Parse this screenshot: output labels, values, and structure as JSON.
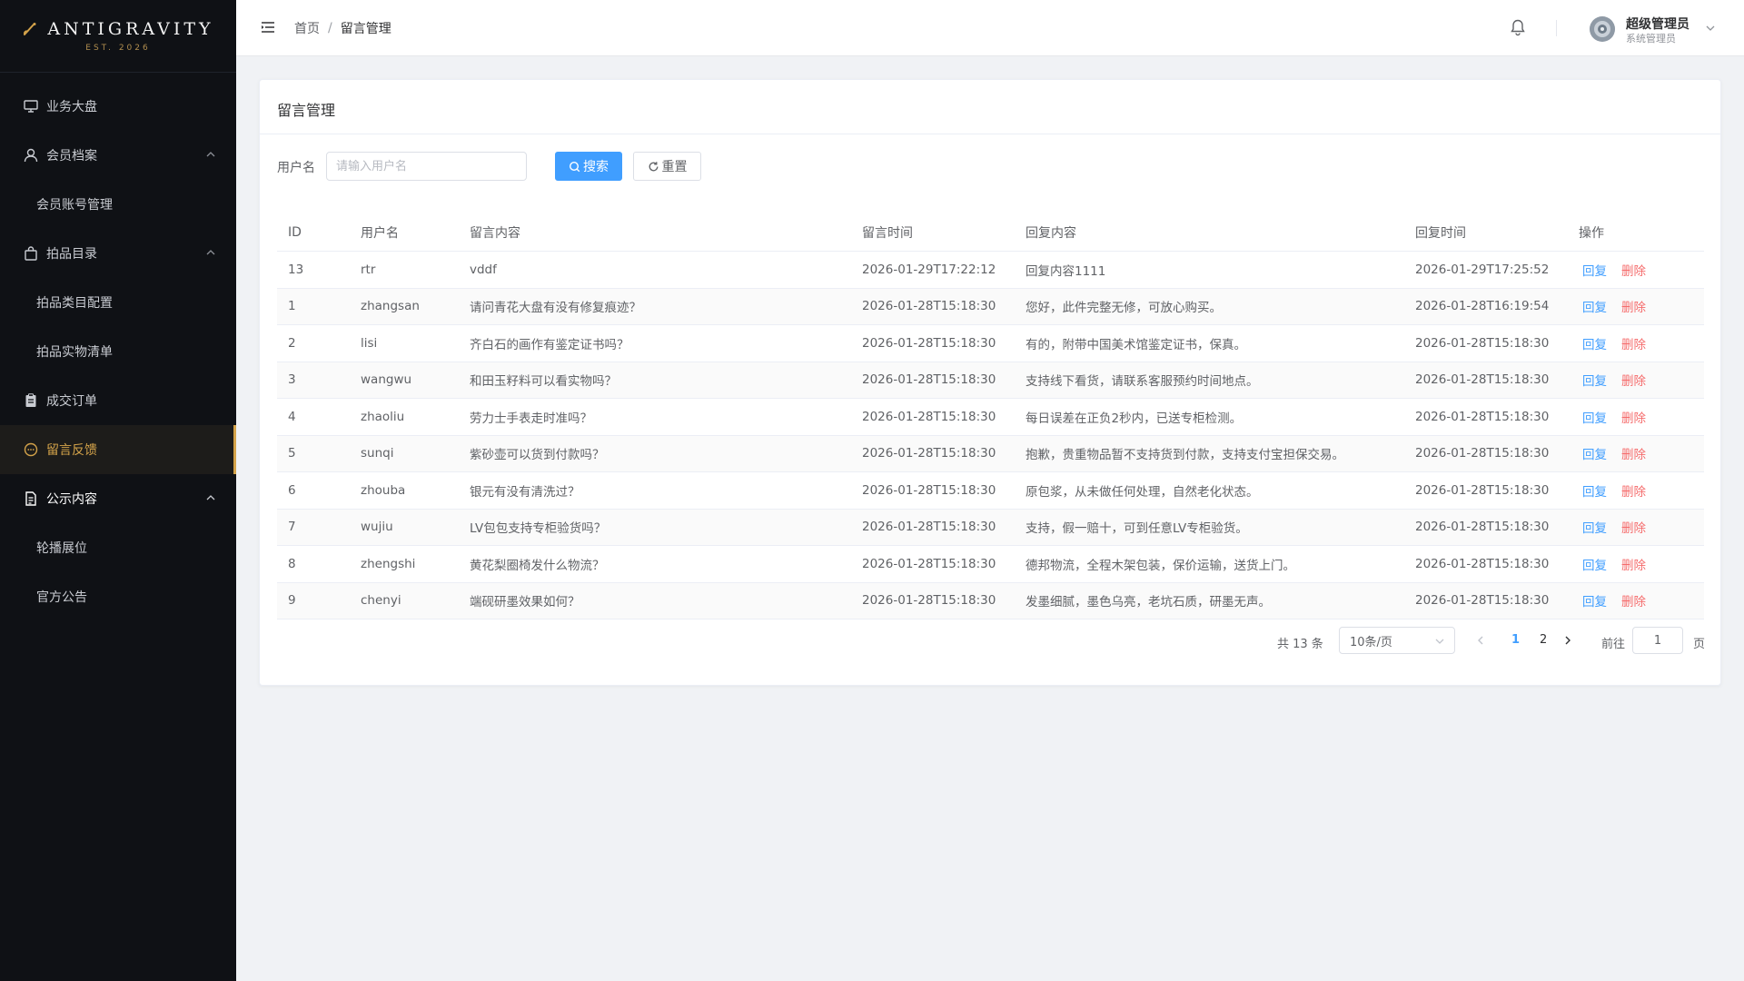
{
  "brand": {
    "name": "ANTIGRAVITY",
    "est": "EST. 2026"
  },
  "sidebar": {
    "items": [
      {
        "label": "业务大盘",
        "icon": "monitor-icon"
      },
      {
        "label": "会员档案",
        "icon": "user-icon"
      },
      {
        "label": "会员账号管理"
      },
      {
        "label": "拍品目录",
        "icon": "bag-icon"
      },
      {
        "label": "拍品类目配置"
      },
      {
        "label": "拍品实物清单"
      },
      {
        "label": "成交订单",
        "icon": "clipboard-icon"
      },
      {
        "label": "留言反馈",
        "icon": "chat-icon"
      },
      {
        "label": "公示内容",
        "icon": "document-icon"
      },
      {
        "label": "轮播展位"
      },
      {
        "label": "官方公告"
      }
    ]
  },
  "header": {
    "breadcrumb_home": "首页",
    "breadcrumb_sep": "/",
    "breadcrumb_current": "留言管理",
    "user_name": "超级管理员",
    "user_role": "系统管理员"
  },
  "card": {
    "title": "留言管理"
  },
  "filter": {
    "label": "用户名",
    "placeholder": "请输入用户名",
    "search_label": "搜索",
    "reset_label": "重置"
  },
  "table": {
    "columns": [
      "ID",
      "用户名",
      "留言内容",
      "留言时间",
      "回复内容",
      "回复时间",
      "操作"
    ],
    "reply_action": "回复",
    "delete_action": "删除",
    "rows": [
      {
        "id": "13",
        "user": "rtr",
        "content": "vddf",
        "time": "2026-01-29T17:22:12",
        "reply": "回复内容1111",
        "reply_time": "2026-01-29T17:25:52"
      },
      {
        "id": "1",
        "user": "zhangsan",
        "content": "请问青花大盘有没有修复痕迹？",
        "time": "2026-01-28T15:18:30",
        "reply": "您好，此件完整无修，可放心购买。",
        "reply_time": "2026-01-28T16:19:54"
      },
      {
        "id": "2",
        "user": "lisi",
        "content": "齐白石的画作有鉴定证书吗？",
        "time": "2026-01-28T15:18:30",
        "reply": "有的，附带中国美术馆鉴定证书，保真。",
        "reply_time": "2026-01-28T15:18:30"
      },
      {
        "id": "3",
        "user": "wangwu",
        "content": "和田玉籽料可以看实物吗？",
        "time": "2026-01-28T15:18:30",
        "reply": "支持线下看货，请联系客服预约时间地点。",
        "reply_time": "2026-01-28T15:18:30"
      },
      {
        "id": "4",
        "user": "zhaoliu",
        "content": "劳力士手表走时准吗？",
        "time": "2026-01-28T15:18:30",
        "reply": "每日误差在正负2秒内，已送专柜检测。",
        "reply_time": "2026-01-28T15:18:30"
      },
      {
        "id": "5",
        "user": "sunqi",
        "content": "紫砂壶可以货到付款吗？",
        "time": "2026-01-28T15:18:30",
        "reply": "抱歉，贵重物品暂不支持货到付款，支持支付宝担保交易。",
        "reply_time": "2026-01-28T15:18:30"
      },
      {
        "id": "6",
        "user": "zhouba",
        "content": "银元有没有清洗过？",
        "time": "2026-01-28T15:18:30",
        "reply": "原包浆，从未做任何处理，自然老化状态。",
        "reply_time": "2026-01-28T15:18:30"
      },
      {
        "id": "7",
        "user": "wujiu",
        "content": "LV包包支持专柜验货吗？",
        "time": "2026-01-28T15:18:30",
        "reply": "支持，假一赔十，可到任意LV专柜验货。",
        "reply_time": "2026-01-28T15:18:30"
      },
      {
        "id": "8",
        "user": "zhengshi",
        "content": "黄花梨圈椅发什么物流？",
        "time": "2026-01-28T15:18:30",
        "reply": "德邦物流，全程木架包装，保价运输，送货上门。",
        "reply_time": "2026-01-28T15:18:30"
      },
      {
        "id": "9",
        "user": "chenyi",
        "content": "端砚研墨效果如何？",
        "time": "2026-01-28T15:18:30",
        "reply": "发墨细腻，墨色乌亮，老坑石质，研墨无声。",
        "reply_time": "2026-01-28T15:18:30"
      }
    ]
  },
  "pagination": {
    "total_text": "共 13 条",
    "page_size": "10条/页",
    "pages": [
      "1",
      "2"
    ],
    "current_page": "1",
    "goto_label": "前往",
    "goto_value": "1",
    "page_suffix": "页"
  }
}
